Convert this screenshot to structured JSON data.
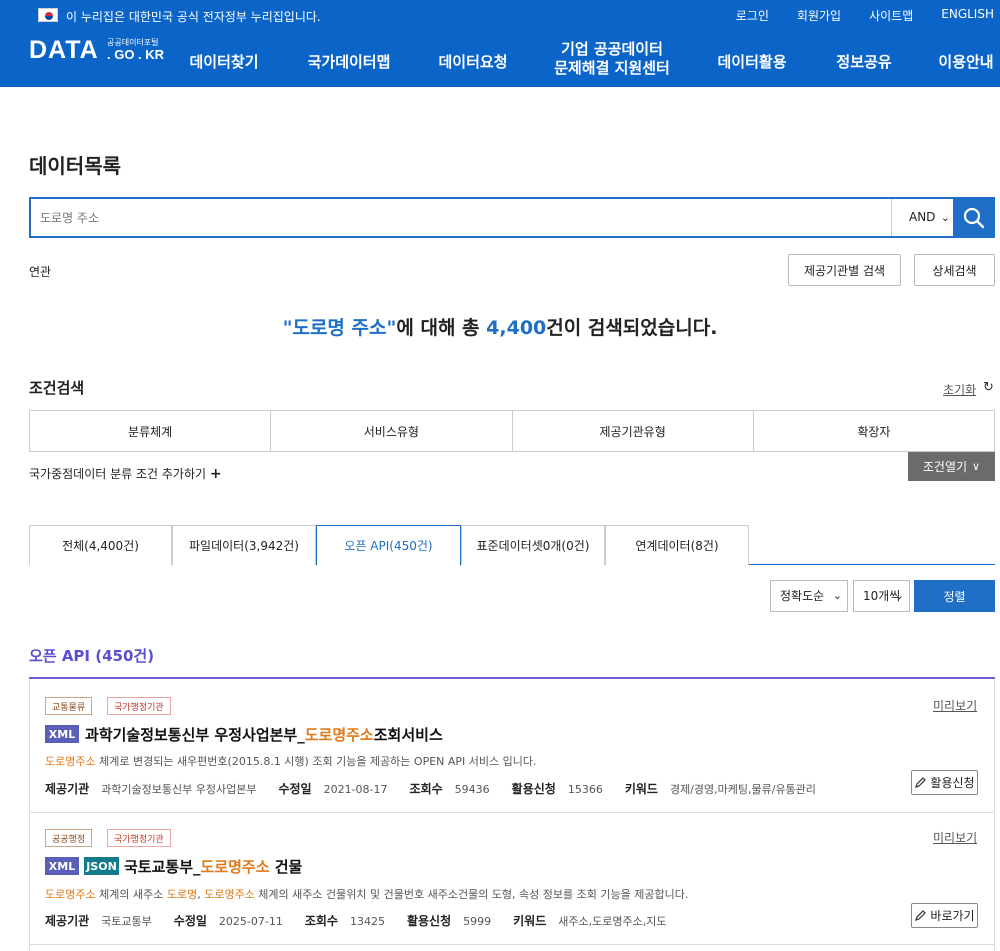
{
  "gov_banner": {
    "text": "이 누리집은 대한민국 공식 전자정부 누리집입니다."
  },
  "top_links": [
    "로그인",
    "회원가입",
    "사이트맵",
    "ENGLISH"
  ],
  "logo": {
    "main": "DATA",
    "sub1": "공공데이터포털",
    "sub2": ". GO . KR"
  },
  "menu": [
    "데이터찾기",
    "국가데이터맵",
    "데이터요청",
    "기업 공공데이터",
    "문제해결 지원센터",
    "데이터활용",
    "정보공유",
    "이용안내"
  ],
  "page_title": "데이터목록",
  "search": {
    "placeholder": "도로명 주소",
    "operator": "AND"
  },
  "related_label": "연관",
  "buttons": {
    "org_search": "제공기관별 검색",
    "detail_search": "상세검색"
  },
  "result": {
    "quote_open": "\"",
    "query": "도로명 주소",
    "quote_close": "\"",
    "mid": "에 대해 총 ",
    "count": "4,400",
    "tail": "건이 검색되었습니다."
  },
  "conditions": {
    "title": "조건검색",
    "reset": "초기화",
    "headers": [
      "분류체계",
      "서비스유형",
      "제공기관유형",
      "확장자"
    ],
    "add": "국가중점데이터 분류 조건 추가하기",
    "open": "조건열기"
  },
  "tabs": [
    "전체(4,400건)",
    "파일데이터(3,942건)",
    "오픈 API(450건)",
    "표준데이터셋0개(0건)",
    "연계데이터(8건)"
  ],
  "sort": {
    "order": "정확도순",
    "per_page": "10개씩",
    "button": "정렬"
  },
  "section_title": "오픈 API (450건)",
  "items": [
    {
      "tags": [
        "교통물류",
        "국가행정기관"
      ],
      "preview": "미리보기",
      "formats": [
        "XML"
      ],
      "title_pre": "과학기술정보통신부 우정사업본부_",
      "title_hl": "도로명주소",
      "title_post": "조회서비스",
      "desc_hl": "도로명주소",
      "desc_rest": " 체계로 변경되는 새우편번호(2015.8.1 시행) 조회 기능을 제공하는 OPEN API 서비스 입니다.",
      "meta": {
        "org_label": "제공기관",
        "org": "과학기술정보통신부 우정사업본부",
        "mod_label": "수정일",
        "mod": "2021-08-17",
        "views_label": "조회수",
        "views": "59436",
        "apply_label": "활용신청",
        "apply": "15366",
        "kw_label": "키워드",
        "kw": "경제/경영,마케팅,물류/유통관리"
      },
      "action": "활용신청"
    },
    {
      "tags": [
        "공공행정",
        "국가행정기관"
      ],
      "preview": "미리보기",
      "formats": [
        "XML",
        "JSON"
      ],
      "title_pre": "국토교통부_",
      "title_hl": "도로명주소",
      "title_post": " 건물",
      "desc_hl1": "도로명주소",
      "desc_mid1": " 체계의 새주소 ",
      "desc_hl2": "도로명",
      "desc_mid2": ", ",
      "desc_hl3": "도로명주소",
      "desc_rest": " 체계의 새주소 건물위치 및 건물번호 새주소건물의 도형, 속성 정보를 조회 기능을 제공합니다.",
      "meta": {
        "org_label": "제공기관",
        "org": "국토교통부",
        "mod_label": "수정일",
        "mod": "2025-07-11",
        "views_label": "조회수",
        "views": "13425",
        "apply_label": "활용신청",
        "apply": "5999",
        "kw_label": "키워드",
        "kw": "새주소,도로명주소,지도"
      },
      "action": "바로가기"
    }
  ],
  "colors": {
    "header_bg": "#0b64c8",
    "accent_blue": "#1f6fc6",
    "accent_purple": "#5a4fcf",
    "highlight_orange": "#e07a1a"
  }
}
